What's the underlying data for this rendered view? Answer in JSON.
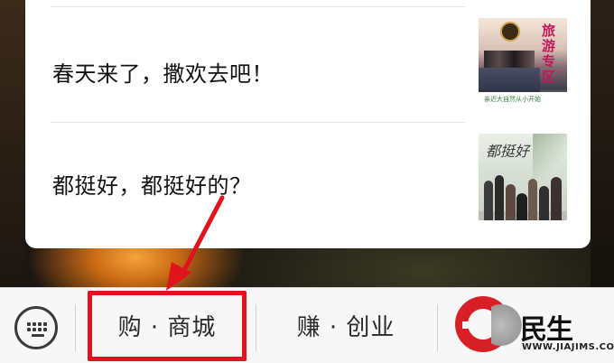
{
  "articles": [
    {
      "title": "春天来了，撒欢去吧！",
      "thumbnail": "travel-banner"
    },
    {
      "title": "都挺好，都挺好的？",
      "thumbnail": "tv-drama-poster"
    }
  ],
  "thumb1": {
    "headline": "旅游专区",
    "caption": "亲近大自然从小开始"
  },
  "thumb2": {
    "calligraphy": "都挺好"
  },
  "tabbar": {
    "keyboard_icon": "keyboard-icon",
    "tabs": [
      {
        "label": "购 · 商城"
      },
      {
        "label": "赚 · 创业"
      }
    ]
  },
  "watermark": {
    "brand": "民生",
    "url": "WWW.JIAJIMS.COM"
  },
  "colors": {
    "highlight": "#e0141c",
    "brand_red": "#d81f26",
    "card_bg": "#ffffff",
    "tabbar_bg": "#f7f7f7"
  }
}
